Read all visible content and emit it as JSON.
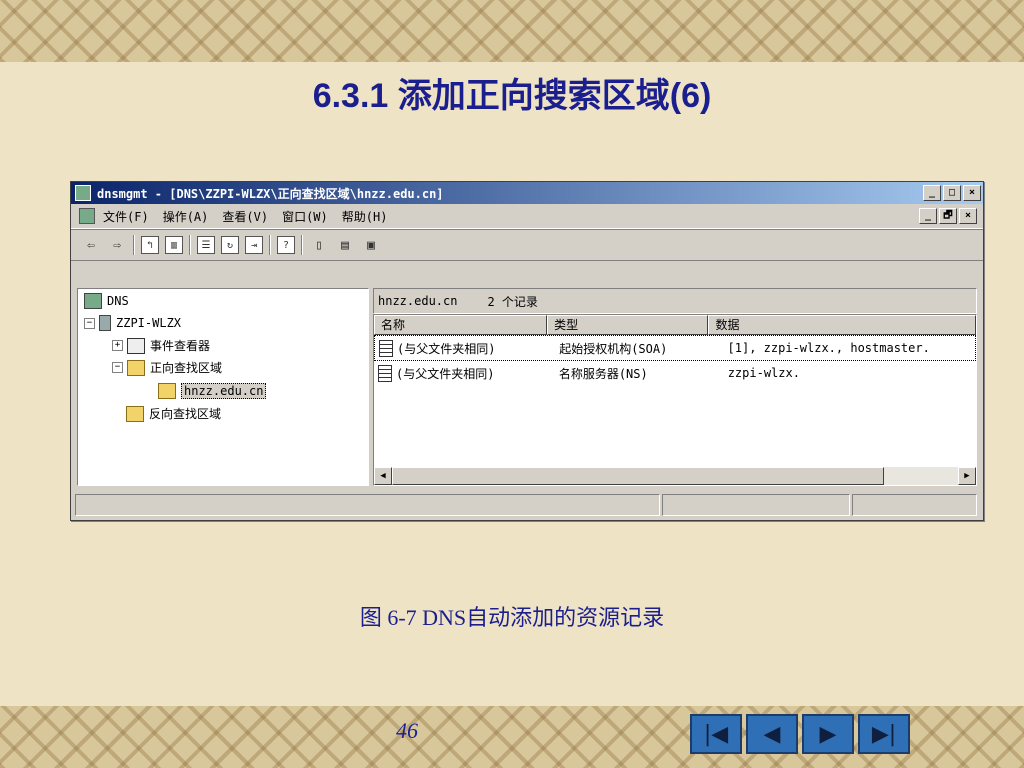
{
  "slide": {
    "title": "6.3.1 添加正向搜索区域(6)",
    "caption": "图 6-7  DNS自动添加的资源记录",
    "page_number": "46"
  },
  "window": {
    "title": "dnsmgmt - [DNS\\ZZPI-WLZX\\正向查找区域\\hnzz.edu.cn]",
    "controls": [
      "_",
      "□",
      "×"
    ]
  },
  "menu": {
    "items": [
      "文件(F)",
      "操作(A)",
      "查看(V)",
      "窗口(W)",
      "帮助(H)"
    ],
    "mdi_controls": [
      "_",
      "🗗",
      "×"
    ]
  },
  "tree": {
    "root": "DNS",
    "server": "ZZPI-WLZX",
    "event_viewer": "事件查看器",
    "forward_zone": "正向查找区域",
    "zone": "hnzz.edu.cn",
    "reverse_zone": "反向查找区域"
  },
  "list": {
    "header_zone": "hnzz.edu.cn",
    "header_count": "2 个记录",
    "columns": [
      "名称",
      "类型",
      "数据"
    ],
    "rows": [
      {
        "name": "(与父文件夹相同)",
        "type": "起始授权机构(SOA)",
        "data": "[1], zzpi-wlzx., hostmaster."
      },
      {
        "name": "(与父文件夹相同)",
        "type": "名称服务器(NS)",
        "data": "zzpi-wlzx."
      }
    ]
  },
  "nav_buttons": [
    "first",
    "previous",
    "next",
    "last"
  ]
}
